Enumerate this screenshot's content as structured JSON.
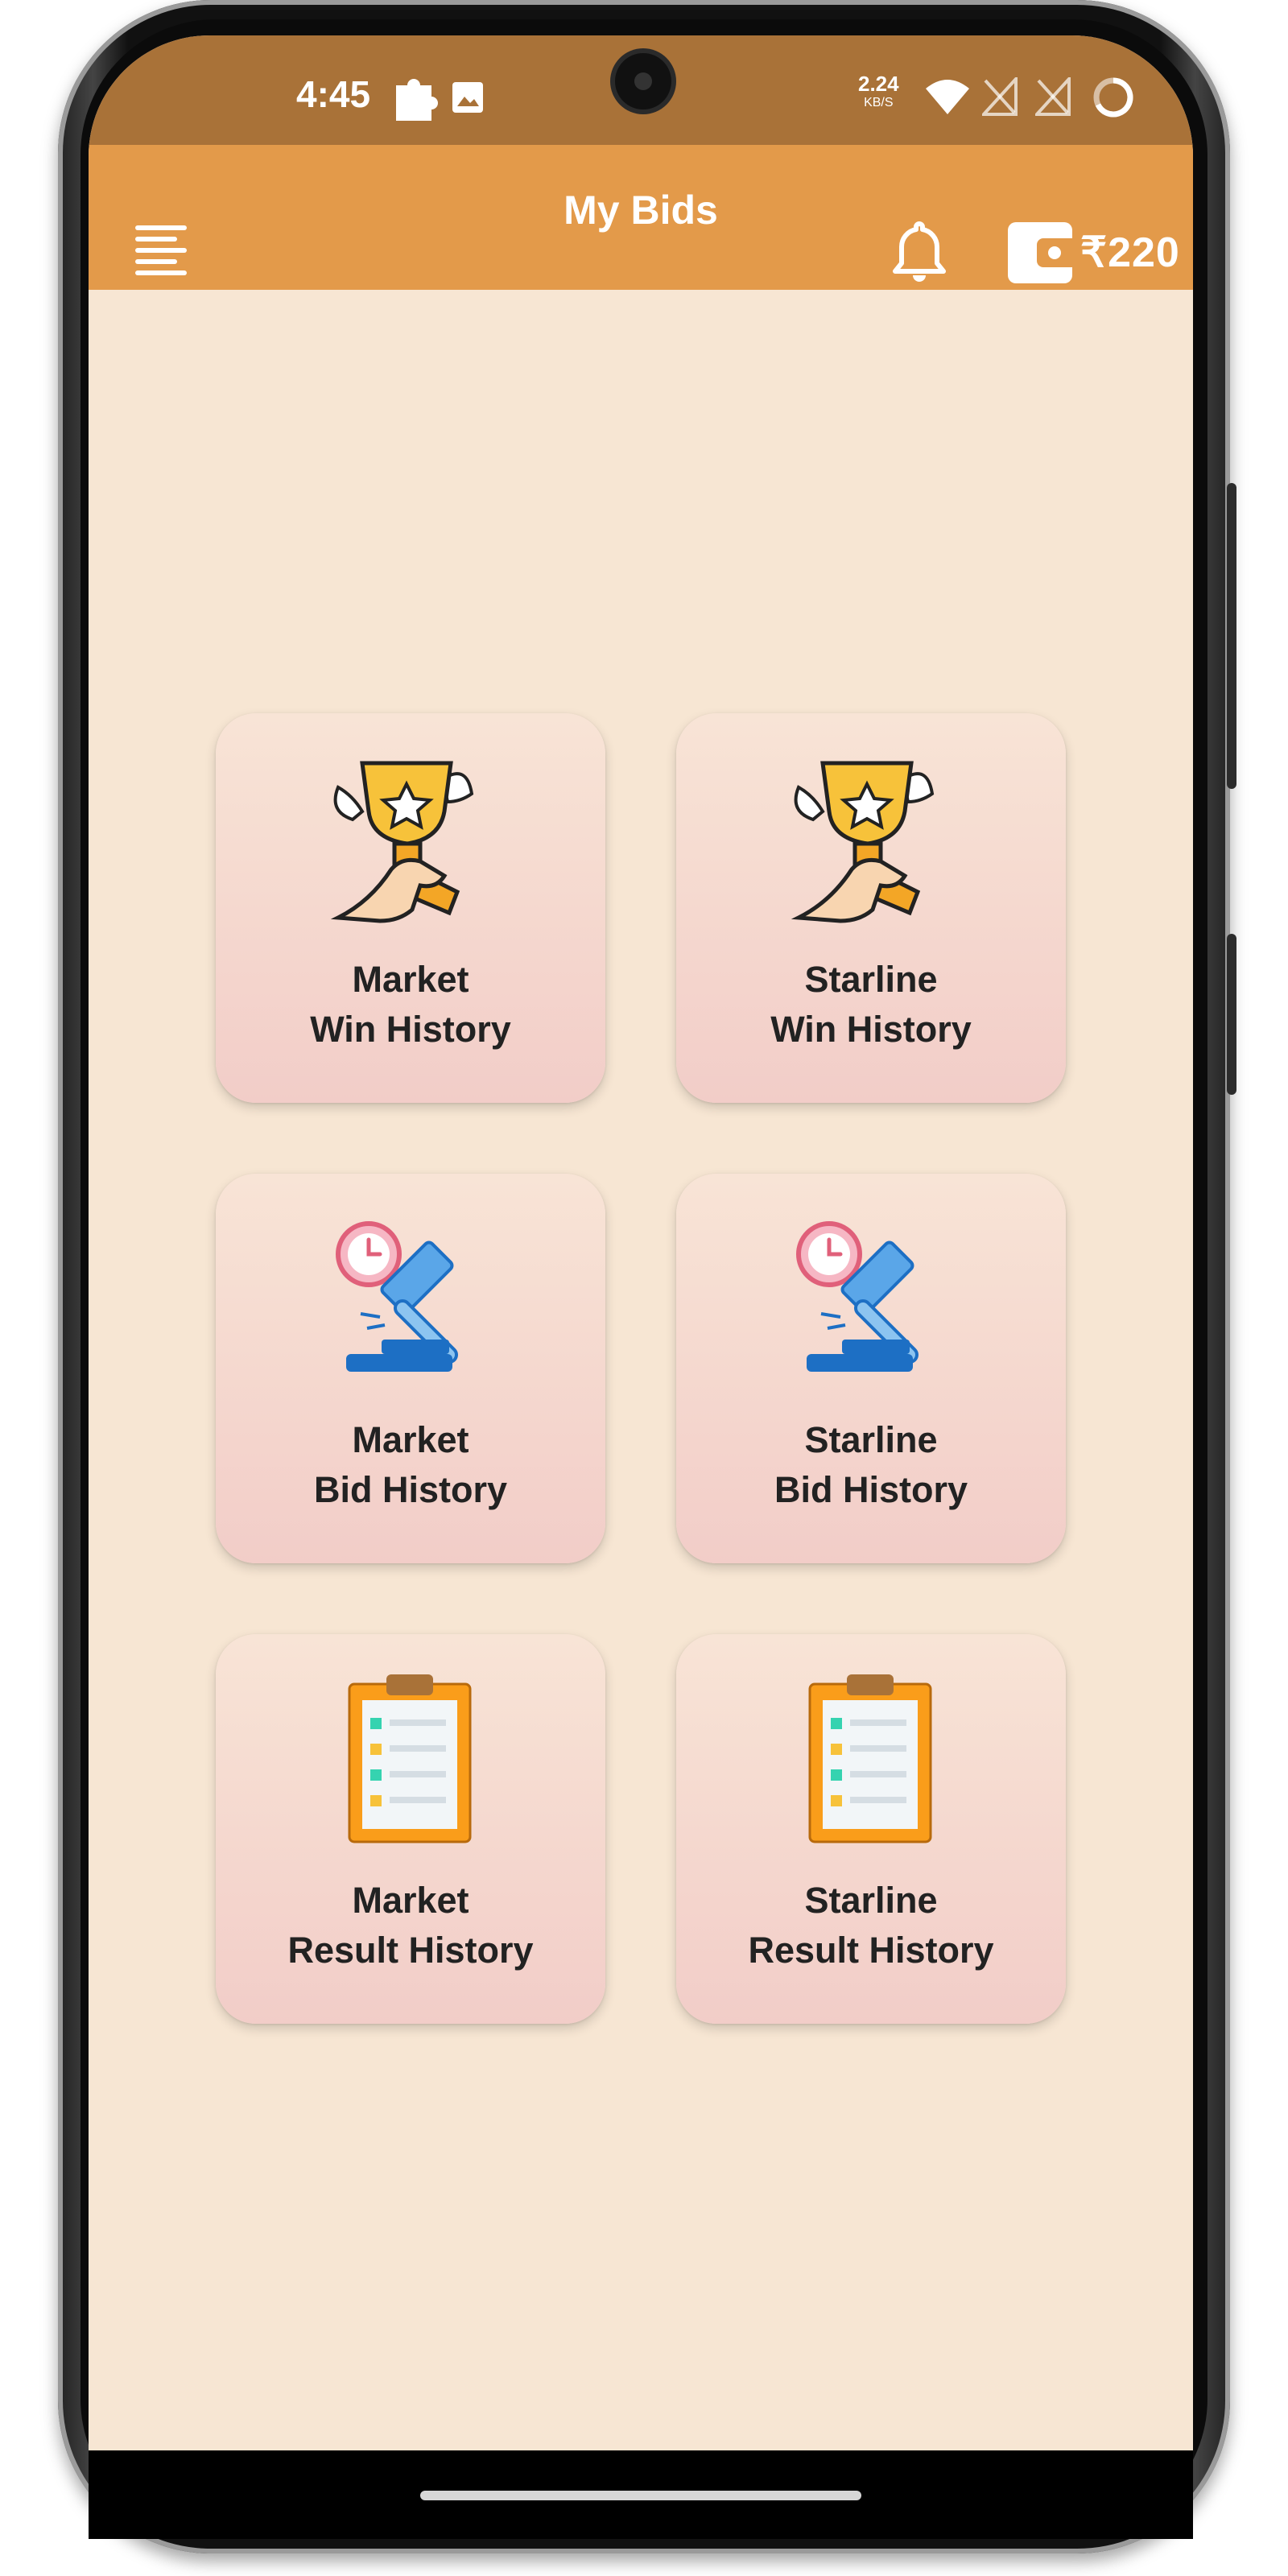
{
  "status_bar": {
    "time": "4:45",
    "net_speed_value": "2.24",
    "net_speed_unit": "KB/S",
    "icons": [
      "puzzle-icon",
      "image-icon",
      "wifi-icon",
      "no-sim-icon",
      "no-sim-icon",
      "battery-ring-icon"
    ]
  },
  "app_bar": {
    "title": "My Bids",
    "wallet_amount": "₹220",
    "icons": [
      "menu-icon",
      "bell-icon",
      "wallet-icon"
    ],
    "colors": {
      "status_bar": "#a97238",
      "app_bar": "#e39a4a",
      "background": "#f7e6d3"
    }
  },
  "cards": [
    {
      "line1": "Market",
      "line2": "Win History",
      "icon": "trophy-hand-icon"
    },
    {
      "line1": "Starline",
      "line2": "Win History",
      "icon": "trophy-hand-icon"
    },
    {
      "line1": "Market",
      "line2": "Bid History",
      "icon": "gavel-clock-icon"
    },
    {
      "line1": "Starline",
      "line2": "Bid History",
      "icon": "gavel-clock-icon"
    },
    {
      "line1": "Market",
      "line2": "Result History",
      "icon": "clipboard-list-icon"
    },
    {
      "line1": "Starline",
      "line2": "Result History",
      "icon": "clipboard-list-icon"
    }
  ]
}
